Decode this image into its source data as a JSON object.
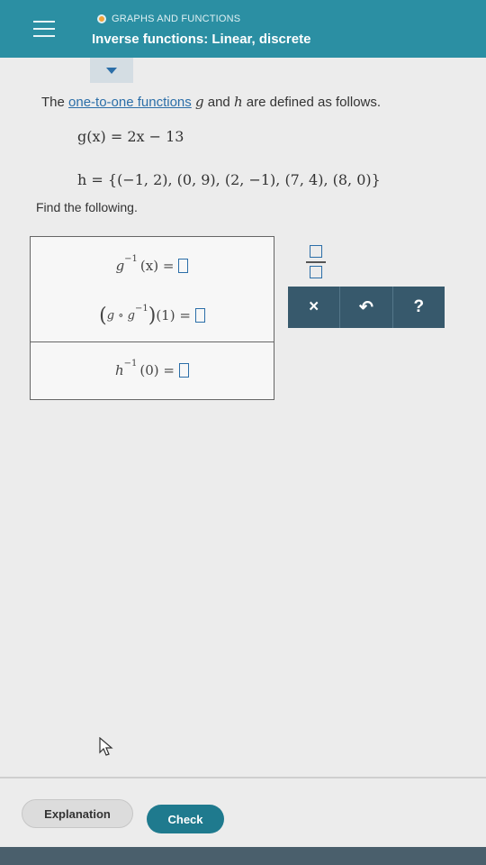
{
  "header": {
    "topic": "GRAPHS AND FUNCTIONS",
    "title": "Inverse functions: Linear, discrete"
  },
  "problem": {
    "prefix": "The ",
    "link": "one-to-one functions",
    "var_g": "g",
    "mid": " and ",
    "var_h": "h",
    "suffix": " are defined as follows.",
    "eq_g": "g(x) = 2x − 13",
    "eq_h": "h = {(−1, 2), (0, 9), (2, −1), (7, 4), (8, 0)}",
    "find": "Find the following."
  },
  "answers": {
    "q1_base": "g",
    "q1_sup": "−1",
    "q1_rest": "(x) =",
    "q2_open": "(",
    "q2_inner": "g ∘ g",
    "q2_sup": "−1",
    "q2_close": ")",
    "q2_rest": "(1) =",
    "q3_base": "h",
    "q3_sup": "−1",
    "q3_rest": "(0) ="
  },
  "tools": {
    "clear": "×",
    "undo": "↶",
    "help": "?"
  },
  "footer": {
    "explanation": "Explanation",
    "check": "Check"
  },
  "colors": {
    "header": "#2b8fa3",
    "accent": "#2b6ea8",
    "tool_panel": "#37596c",
    "check": "#1f7a8e"
  }
}
